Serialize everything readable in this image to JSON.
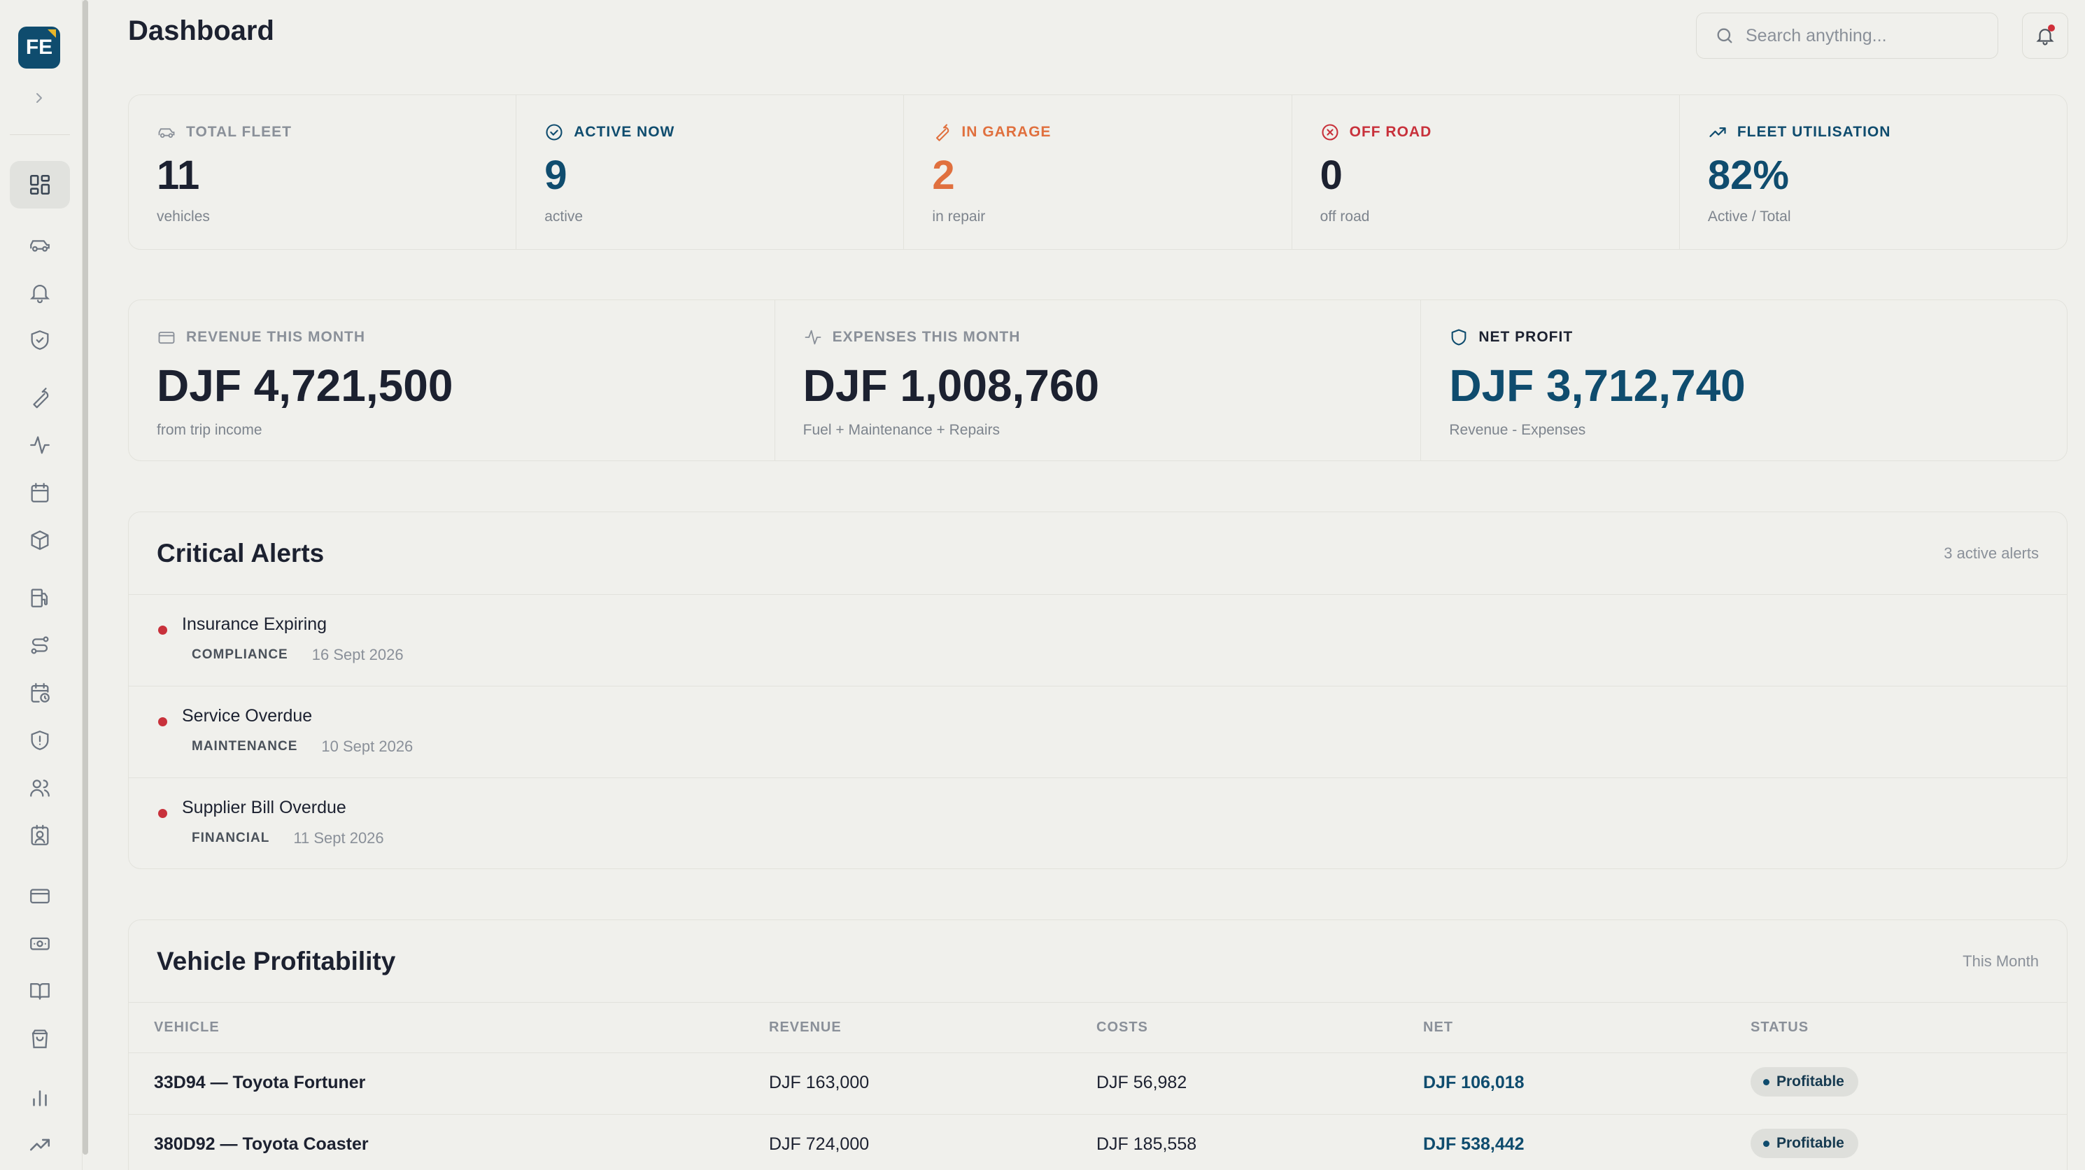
{
  "app": {
    "logo_text": "FE",
    "brand_color": "#0f4c6e"
  },
  "header": {
    "title": "Dashboard",
    "search_placeholder": "Search anything..."
  },
  "sidebar": {
    "items": [
      {
        "icon": "dashboard-icon",
        "active": true
      },
      {
        "icon": "car-icon"
      },
      {
        "icon": "bell-icon"
      },
      {
        "icon": "shield-check-icon"
      },
      {
        "icon": "wrench-icon"
      },
      {
        "icon": "activity-icon"
      },
      {
        "icon": "calendar-icon"
      },
      {
        "icon": "package-icon"
      },
      {
        "icon": "fuel-icon"
      },
      {
        "icon": "route-icon"
      },
      {
        "icon": "calendar-clock-icon"
      },
      {
        "icon": "shield-alert-icon"
      },
      {
        "icon": "users-icon"
      },
      {
        "icon": "contact-icon"
      },
      {
        "icon": "credit-card-icon"
      },
      {
        "icon": "banknote-icon"
      },
      {
        "icon": "book-icon"
      },
      {
        "icon": "shopping-bag-icon"
      },
      {
        "icon": "bar-chart-icon"
      },
      {
        "icon": "trending-up-icon"
      }
    ]
  },
  "stats": [
    {
      "label": "TOTAL FLEET",
      "value": "11",
      "sub": "vehicles",
      "color": "#1c2130",
      "label_color": "#8a9099",
      "icon": "car-icon"
    },
    {
      "label": "ACTIVE NOW",
      "value": "9",
      "sub": "active",
      "color": "#0f4c6e",
      "label_color": "#0f4c6e",
      "icon": "check-circle-icon"
    },
    {
      "label": "IN GARAGE",
      "value": "2",
      "sub": "in repair",
      "color": "#e0703e",
      "label_color": "#e0703e",
      "icon": "wrench-icon"
    },
    {
      "label": "OFF ROAD",
      "value": "0",
      "sub": "off road",
      "color": "#1c2130",
      "label_color": "#c8313b",
      "icon": "x-circle-icon"
    },
    {
      "label": "FLEET UTILISATION",
      "value": "82%",
      "sub": "Active / Total",
      "color": "#0f4c6e",
      "label_color": "#0f4c6e",
      "icon": "trending-up-icon"
    }
  ],
  "money": [
    {
      "label": "REVENUE THIS MONTH",
      "value": "DJF 4,721,500",
      "sub": "from trip income",
      "color": "#1c2130",
      "label_color": "#8a9099",
      "icon": "credit-card-icon"
    },
    {
      "label": "EXPENSES THIS MONTH",
      "value": "DJF 1,008,760",
      "sub": "Fuel + Maintenance + Repairs",
      "color": "#1c2130",
      "label_color": "#8a9099",
      "icon": "activity-icon"
    },
    {
      "label": "NET PROFIT",
      "value": "DJF 3,712,740",
      "sub": "Revenue - Expenses",
      "color": "#0f4c6e",
      "label_color": "#1c2130",
      "icon": "shield-icon"
    }
  ],
  "alerts": {
    "title": "Critical Alerts",
    "count_text": "3 active alerts",
    "items": [
      {
        "title": "Insurance Expiring",
        "tag": "COMPLIANCE",
        "date": "16 Sept 2026"
      },
      {
        "title": "Service Overdue",
        "tag": "MAINTENANCE",
        "date": "10 Sept 2026"
      },
      {
        "title": "Supplier Bill Overdue",
        "tag": "FINANCIAL",
        "date": "11 Sept 2026"
      }
    ]
  },
  "profitability": {
    "title": "Vehicle Profitability",
    "period": "This Month",
    "columns": [
      "VEHICLE",
      "REVENUE",
      "COSTS",
      "NET",
      "STATUS"
    ],
    "rows": [
      {
        "vehicle": "33D94 — Toyota Fortuner",
        "revenue": "DJF 163,000",
        "costs": "DJF 56,982",
        "net": "DJF 106,018",
        "status": "Profitable"
      },
      {
        "vehicle": "380D92 — Toyota Coaster",
        "revenue": "DJF 724,000",
        "costs": "DJF 185,558",
        "net": "DJF 538,442",
        "status": "Profitable"
      }
    ]
  }
}
